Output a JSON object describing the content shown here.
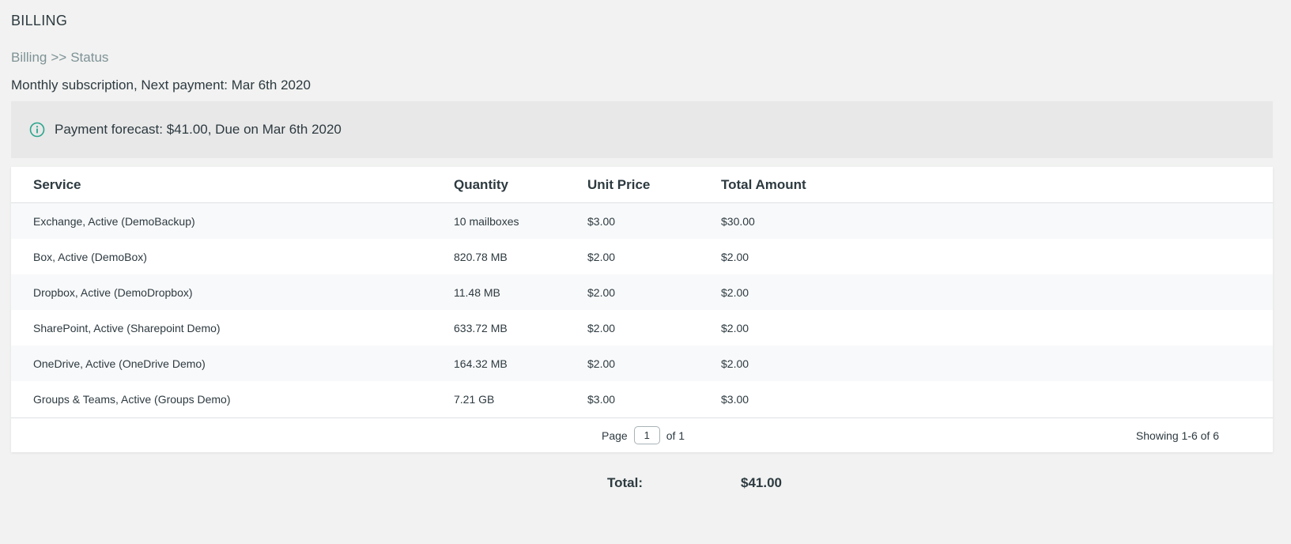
{
  "page": {
    "title": "BILLING",
    "breadcrumb": {
      "first": "Billing",
      "separator": ">>",
      "current": "Status"
    },
    "subscription_text": "Monthly subscription, Next payment: Mar 6th 2020"
  },
  "forecast": {
    "icon": "info-circle-icon",
    "icon_color": "#2aa58c",
    "text": "Payment forecast: $41.00, Due on Mar 6th 2020"
  },
  "table": {
    "headers": {
      "service": "Service",
      "quantity": "Quantity",
      "unit_price": "Unit Price",
      "total_amount": "Total Amount"
    },
    "rows": [
      {
        "service": "Exchange, Active (DemoBackup)",
        "quantity": "10 mailboxes",
        "unit_price": "$3.00",
        "total_amount": "$30.00"
      },
      {
        "service": "Box, Active (DemoBox)",
        "quantity": "820.78 MB",
        "unit_price": "$2.00",
        "total_amount": "$2.00"
      },
      {
        "service": "Dropbox, Active (DemoDropbox)",
        "quantity": "11.48 MB",
        "unit_price": "$2.00",
        "total_amount": "$2.00"
      },
      {
        "service": "SharePoint, Active (Sharepoint Demo)",
        "quantity": "633.72 MB",
        "unit_price": "$2.00",
        "total_amount": "$2.00"
      },
      {
        "service": "OneDrive, Active (OneDrive Demo)",
        "quantity": "164.32 MB",
        "unit_price": "$2.00",
        "total_amount": "$2.00"
      },
      {
        "service": "Groups & Teams, Active (Groups Demo)",
        "quantity": "7.21 GB",
        "unit_price": "$3.00",
        "total_amount": "$3.00"
      }
    ],
    "pager": {
      "page_label": "Page",
      "page_value": "1",
      "of_label": "of 1"
    },
    "showing": "Showing 1-6 of 6"
  },
  "summary": {
    "total_label": "Total:",
    "total_value": "$41.00"
  }
}
